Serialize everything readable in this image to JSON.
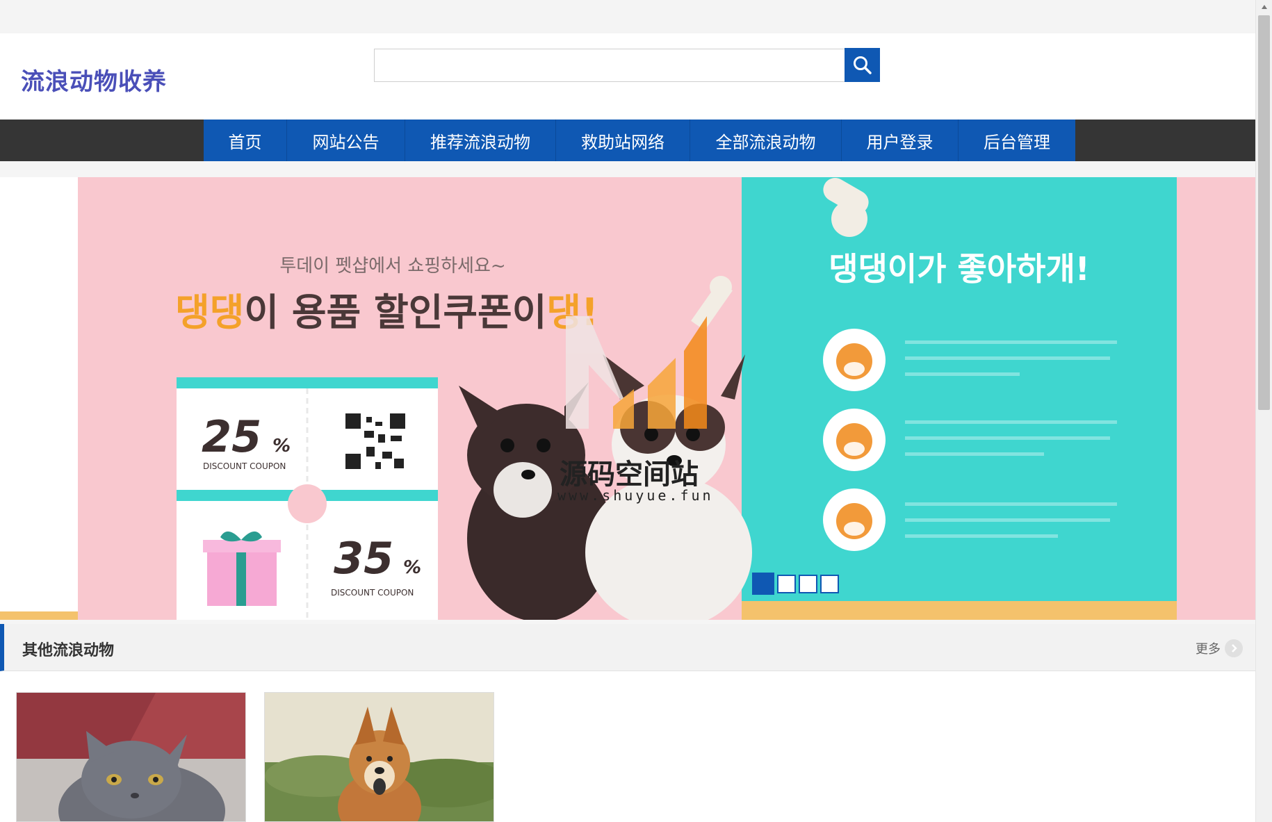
{
  "header": {
    "logo_text": "流浪动物收养",
    "search": {
      "value": "",
      "placeholder": ""
    }
  },
  "nav": {
    "items": [
      {
        "label": "首页"
      },
      {
        "label": "网站公告"
      },
      {
        "label": "推荐流浪动物"
      },
      {
        "label": "救助站网络"
      },
      {
        "label": "全部流浪动物"
      },
      {
        "label": "用户登录"
      },
      {
        "label": "后台管理"
      }
    ]
  },
  "banner": {
    "slogan_small": "투데이 펫샵에서 쇼핑하세요~",
    "slogan_large_a": "댕댕",
    "slogan_large_b": "이 용품 할인쿠폰이",
    "slogan_large_c": "댕!",
    "right_title": "댕댕이가 좋아하개!",
    "coupon_1_value": "25",
    "coupon_1_unit": "%",
    "coupon_1_label": "DISCOUNT COUPON",
    "coupon_2_value": "35",
    "coupon_2_unit": "%",
    "coupon_2_label": "DISCOUNT COUPON",
    "watermark_title": "源码空间站",
    "watermark_url": "www.shuyue.fun",
    "slide_count": 4,
    "active_slide": 1
  },
  "section": {
    "title": "其他流浪动物",
    "more_label": "更多"
  },
  "colors": {
    "brand_blue": "#0f58b3",
    "nav_bar": "#353535",
    "logo": "#4a4fb8",
    "banner_pink": "#f9c8cf",
    "banner_teal": "#3fd6cf"
  }
}
